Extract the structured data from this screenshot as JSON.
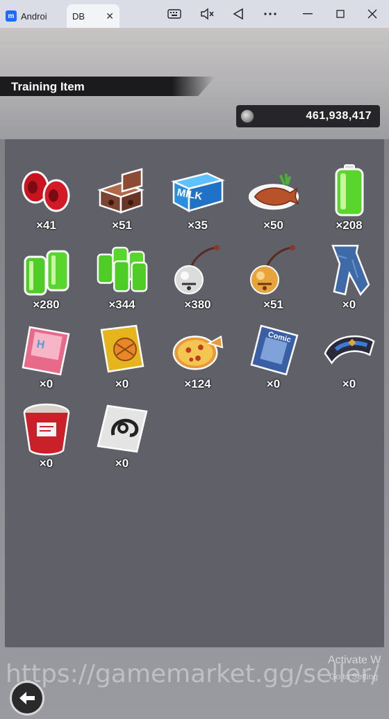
{
  "window": {
    "tabs": [
      {
        "label": "Android",
        "icon": "app-logo-icon",
        "close": ""
      },
      {
        "label": "DB",
        "icon": "game-icon",
        "close": "✕"
      }
    ]
  },
  "header": {
    "title": "Training Item",
    "currency_value": "461,938,417"
  },
  "items": [
    {
      "name": "Red Weights",
      "icon": "red-weights-icon",
      "count": "×41"
    },
    {
      "name": "Bricks",
      "icon": "bricks-icon",
      "count": "×51"
    },
    {
      "name": "Milk Crate",
      "icon": "milk-crate-icon",
      "count": "×35",
      "label": "MILK"
    },
    {
      "name": "Fish Dish",
      "icon": "fish-dish-icon",
      "count": "×50"
    },
    {
      "name": "Battery",
      "icon": "battery-icon",
      "count": "×208"
    },
    {
      "name": "Battery Pair",
      "icon": "battery-pair-icon",
      "count": "×280"
    },
    {
      "name": "Battery Pack",
      "icon": "battery-pack-icon",
      "count": "×344"
    },
    {
      "name": "Silver Bell",
      "icon": "silver-bell-icon",
      "count": "×380"
    },
    {
      "name": "Gold Bell",
      "icon": "gold-bell-icon",
      "count": "×51"
    },
    {
      "name": "Jeans",
      "icon": "jeans-icon",
      "count": "×0"
    },
    {
      "name": "Magazine",
      "icon": "magazine-icon",
      "count": "×0"
    },
    {
      "name": "Game Box",
      "icon": "game-box-icon",
      "count": "×0"
    },
    {
      "name": "Pizza",
      "icon": "pizza-icon",
      "count": "×124"
    },
    {
      "name": "Comic",
      "icon": "comic-icon",
      "count": "×0",
      "label": "Comic"
    },
    {
      "name": "Scarf",
      "icon": "scarf-icon",
      "count": "×0"
    },
    {
      "name": "Cup Noodle",
      "icon": "cup-noodle-icon",
      "count": "×0"
    },
    {
      "name": "Capsule Token",
      "icon": "capsule-token-icon",
      "count": "×0"
    }
  ],
  "overlay": {
    "watermark": "https://gamemarket.gg/seller/",
    "activate_title": "Activate W",
    "activate_sub": "Go to Setting"
  },
  "colors": {
    "panel": "#5f6068",
    "header_bar": "#1b1b1d"
  }
}
